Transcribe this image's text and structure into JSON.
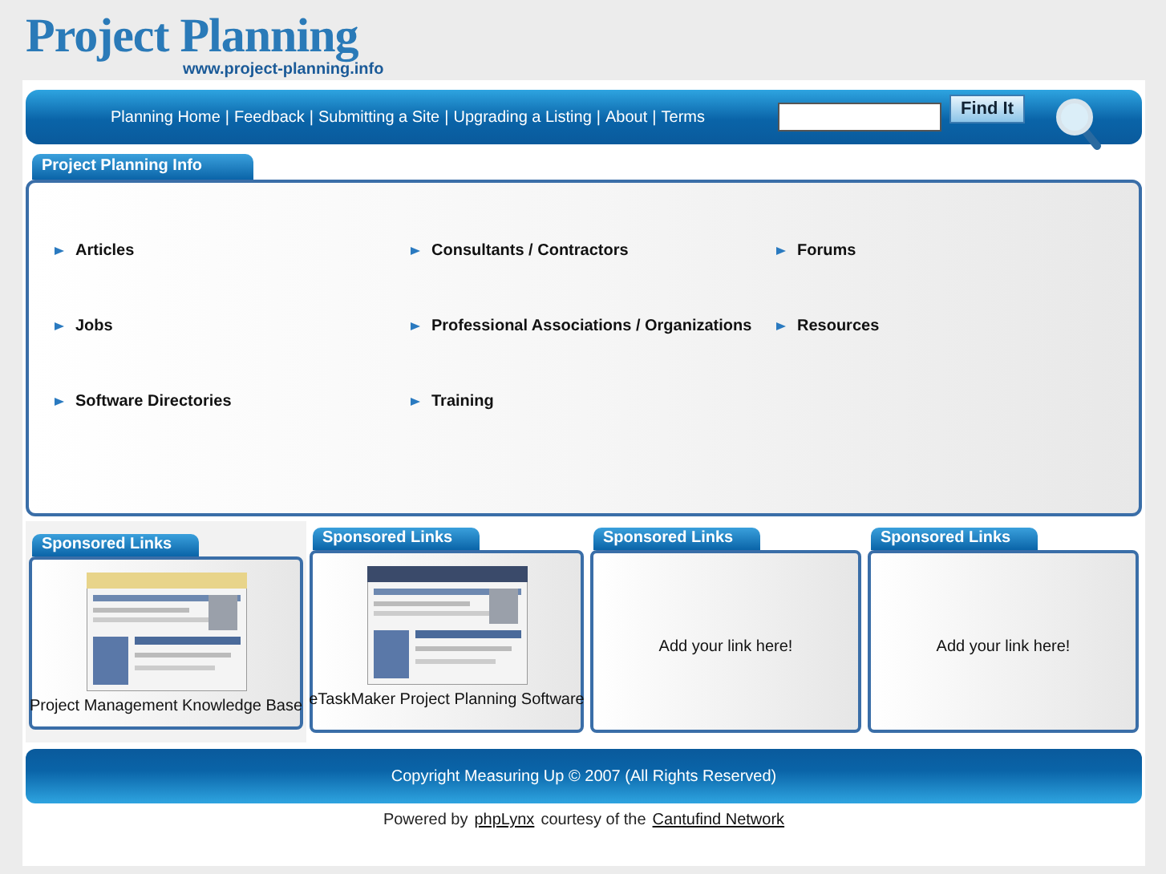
{
  "logo": {
    "title": "Project Planning",
    "url": "www.project-planning.info"
  },
  "nav": {
    "separator": "|",
    "links": [
      "Planning Home",
      "Feedback",
      "Submitting a Site",
      "Upgrading a Listing",
      "About",
      "Terms"
    ]
  },
  "search": {
    "button": "Find It"
  },
  "info": {
    "tab": "Project Planning Info",
    "columns": [
      [
        "Articles",
        "Jobs",
        "Software Directories"
      ],
      [
        "Consultants / Contractors",
        "Professional Associations / Organizations",
        "Training"
      ],
      [
        "Forums",
        "Resources"
      ]
    ]
  },
  "sponsored": [
    {
      "tab": "Sponsored Links",
      "kind": "site",
      "label": "Project Management Knowledge Base"
    },
    {
      "tab": "Sponsored Links",
      "kind": "site",
      "label": "eTaskMaker Project Planning Software"
    },
    {
      "tab": "Sponsored Links",
      "kind": "empty",
      "label": "Add your link here!"
    },
    {
      "tab": "Sponsored Links",
      "kind": "empty",
      "label": "Add your link here!"
    }
  ],
  "footer": {
    "copyright": "Copyright Measuring Up © 2007 (All Rights Reserved)",
    "powered": {
      "before": "Powered by",
      "link1": "phpLynx",
      "middle": "courtesy of the",
      "link2": "Cantufind Network"
    }
  }
}
